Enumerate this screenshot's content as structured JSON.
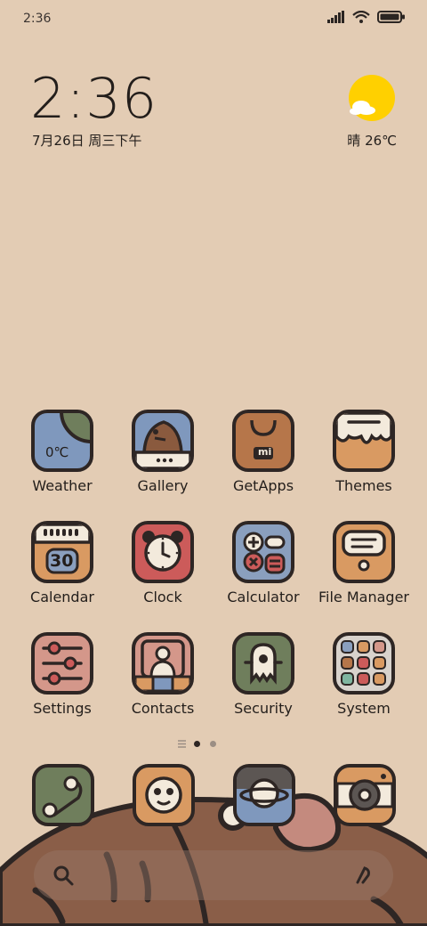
{
  "status_bar": {
    "time": "2:36"
  },
  "clock_widget": {
    "time": "2:36",
    "date": "7月26日 周三下午"
  },
  "weather_widget": {
    "text": "晴 26℃",
    "icon": "sun-cloud-icon"
  },
  "apps": [
    {
      "label": "Weather",
      "icon": "weather-icon",
      "icon_text": "0℃"
    },
    {
      "label": "Gallery",
      "icon": "gallery-icon"
    },
    {
      "label": "GetApps",
      "icon": "getapps-icon",
      "icon_text": "mi"
    },
    {
      "label": "Themes",
      "icon": "themes-icon"
    },
    {
      "label": "Calendar",
      "icon": "calendar-icon",
      "icon_text": "30"
    },
    {
      "label": "Clock",
      "icon": "clock-icon"
    },
    {
      "label": "Calculator",
      "icon": "calculator-icon"
    },
    {
      "label": "File Manager",
      "icon": "file-manager-icon"
    },
    {
      "label": "Settings",
      "icon": "settings-icon"
    },
    {
      "label": "Contacts",
      "icon": "contacts-icon"
    },
    {
      "label": "Security",
      "icon": "security-icon"
    },
    {
      "label": "System",
      "icon": "system-folder-icon"
    }
  ],
  "dock": [
    {
      "icon": "phone-icon"
    },
    {
      "icon": "messages-icon"
    },
    {
      "icon": "browser-icon"
    },
    {
      "icon": "camera-icon"
    }
  ],
  "page_indicator": {
    "pages": 2,
    "current": 1
  },
  "colors": {
    "background": "#e3ccb4",
    "outline": "#2e2624",
    "sun": "#ffd000"
  }
}
